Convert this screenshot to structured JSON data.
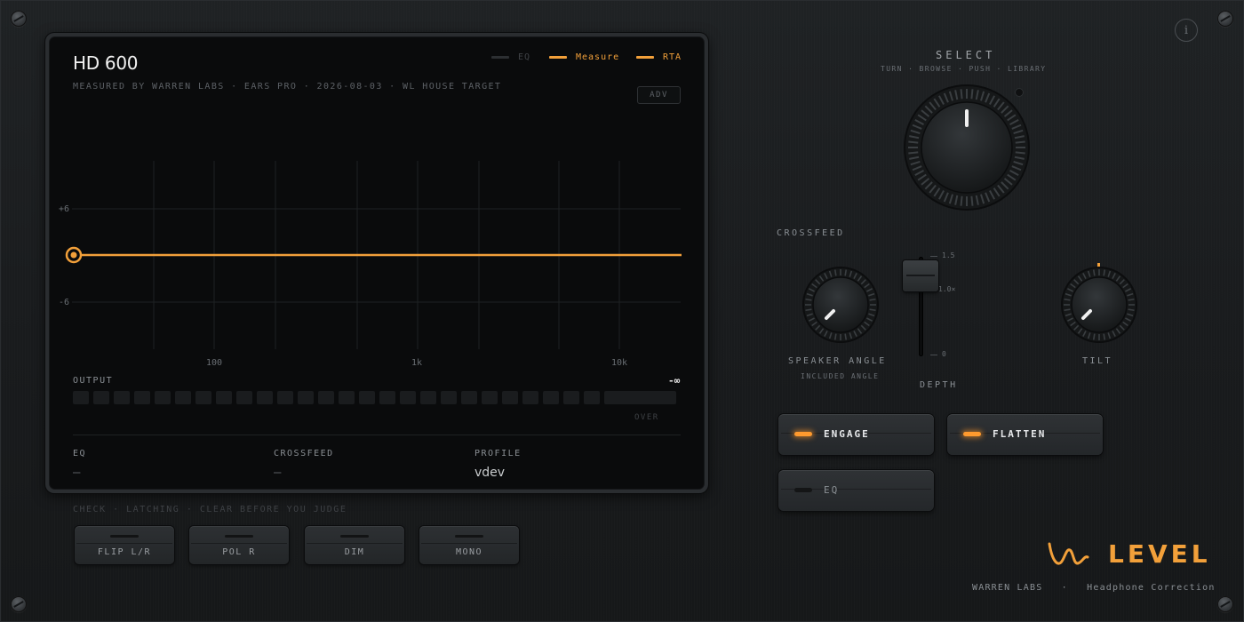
{
  "colors": {
    "accent": "#f2a03a",
    "panel": "#1c1f21",
    "screen": "#0a0b0c"
  },
  "screen": {
    "title": "HD 600",
    "meta": "MEASURED BY WARREN LABS · EARS PRO · 2026-08-03 · WL HOUSE TARGET",
    "legend": [
      {
        "label": "EQ",
        "color": "#3a3d40",
        "active": false
      },
      {
        "label": "Measure",
        "color": "#f2a03a",
        "active": true
      },
      {
        "label": "RTA",
        "color": "#f2a03a",
        "active": true
      }
    ],
    "adv_label": "ADV",
    "y_ticks": [
      "+6",
      "-6"
    ],
    "x_ticks": [
      "100",
      "1k",
      "10k"
    ],
    "output_label": "OUTPUT",
    "output_value": "-∞",
    "over_label": "OVER",
    "stats": [
      {
        "label": "EQ",
        "value": "—"
      },
      {
        "label": "CROSSFEED",
        "value": "—"
      },
      {
        "label": "PROFILE",
        "value": "vdev"
      }
    ]
  },
  "check": {
    "label": "CHECK · LATCHING · CLEAR BEFORE YOU JUDGE",
    "buttons": [
      "FLIP L/R",
      "POL R",
      "DIM",
      "MONO"
    ]
  },
  "select": {
    "title": "SELECT",
    "subtitle": "TURN · BROWSE · PUSH · LIBRARY"
  },
  "crossfeed": {
    "title": "CROSSFEED",
    "speaker_angle_label": "SPEAKER ANGLE",
    "speaker_angle_sub": "INCLUDED ANGLE",
    "depth_label": "DEPTH",
    "depth_ticks": [
      "1.5",
      "1.0×",
      "0"
    ],
    "tilt_label": "TILT"
  },
  "buttons": {
    "engage": "ENGAGE",
    "flatten": "FLATTEN",
    "eq": "EQ"
  },
  "brand": {
    "name": "LEVEL",
    "company": "WARREN LABS",
    "separator": "·",
    "product": "Headphone Correction"
  },
  "info_icon": "i"
}
